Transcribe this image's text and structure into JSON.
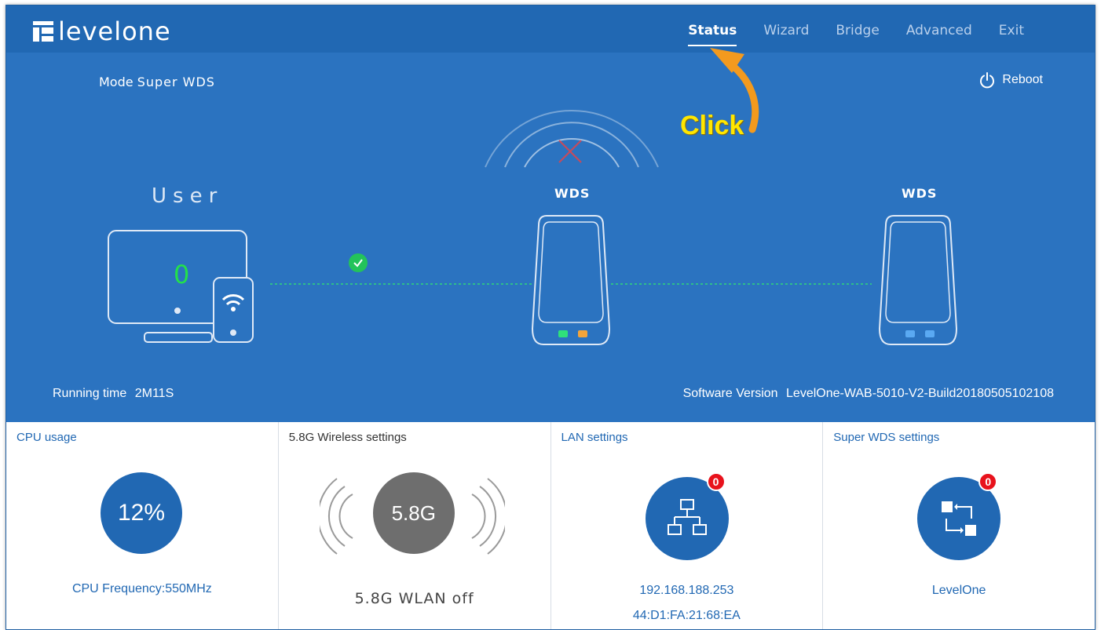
{
  "brand": {
    "logo_text": "levelone"
  },
  "nav": {
    "items": [
      "Status",
      "Wizard",
      "Bridge",
      "Advanced",
      "Exit"
    ],
    "active": "Status"
  },
  "header": {
    "mode_label": "Mode",
    "mode_value": "Super WDS",
    "reboot_label": "Reboot"
  },
  "annotation": {
    "click_label": "Click"
  },
  "topology": {
    "user_label": "User",
    "user_count": "0",
    "node1_label": "WDS",
    "node2_label": "WDS"
  },
  "footer": {
    "running_label": "Running time",
    "running_value": "2M11S",
    "software_label": "Software Version",
    "software_value": "LevelOne-WAB-5010-V2-Build20180505102108"
  },
  "panels": {
    "cpu": {
      "title": "CPU usage",
      "percent": "12%",
      "frequency": "CPU Frequency:550MHz"
    },
    "wireless": {
      "title": "5.8G Wireless settings",
      "band": "5.8G",
      "status": "5.8G WLAN off"
    },
    "lan": {
      "title": "LAN settings",
      "badge": "0",
      "ip": "192.168.188.253",
      "mac": "44:D1:FA:21:68:EA"
    },
    "superwds": {
      "title": "Super WDS settings",
      "badge": "0",
      "name": "LevelOne"
    }
  },
  "colors": {
    "header_bg": "#2168b3",
    "body_bg": "#2b73c0",
    "accent": "#2168b3",
    "ok_green": "#23c35a",
    "badge_red": "#e8121c",
    "annotation_yellow": "#ffe600",
    "annotation_orange": "#f39a1e"
  }
}
